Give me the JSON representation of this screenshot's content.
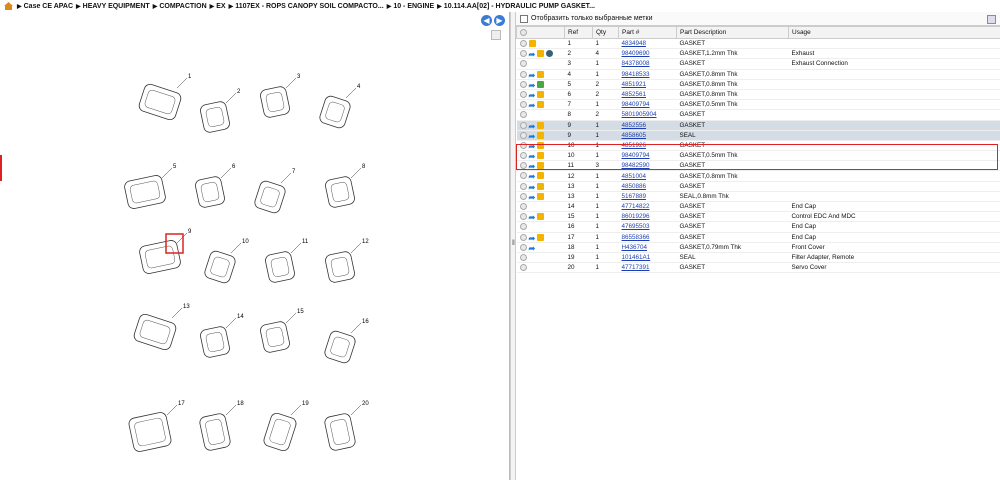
{
  "breadcrumb": [
    "Case CE APAC",
    "HEAVY EQUIPMENT",
    "COMPACTION",
    "EX",
    "1107EX - ROPS CANOPY SOIL COMPACTO...",
    "10 - ENGINE",
    "10.114.AA[02] - HYDRAULIC PUMP GASKET..."
  ],
  "filter_label": "Отобразить только выбранные метки",
  "columns": {
    "ref": "Ref",
    "qty": "Qty",
    "part": "Part #",
    "desc": "Part Description",
    "usage": "Usage"
  },
  "diagram_labels": [
    "1",
    "2",
    "3",
    "4",
    "5",
    "6",
    "7",
    "8",
    "9",
    "10",
    "11",
    "12",
    "13",
    "14",
    "15",
    "16",
    "17",
    "18",
    "19",
    "20"
  ],
  "rows": [
    {
      "icons": [
        "box"
      ],
      "ref": "1",
      "qty": "1",
      "part": "4834948",
      "desc": "GASKET",
      "usage": ""
    },
    {
      "icons": [
        "arrow",
        "box",
        "disc"
      ],
      "ref": "2",
      "qty": "4",
      "part": "98409690",
      "desc": "GASKET,1.2mm Thk",
      "usage": "Exhaust"
    },
    {
      "icons": [],
      "ref": "3",
      "qty": "1",
      "part": "84378008",
      "desc": "GASKET",
      "usage": "Exhaust Connection"
    },
    {
      "icons": [
        "arrow",
        "box"
      ],
      "ref": "4",
      "qty": "1",
      "part": "98418533",
      "desc": "GASKET,0.8mm Thk",
      "usage": ""
    },
    {
      "icons": [
        "arrow",
        "green"
      ],
      "ref": "5",
      "qty": "2",
      "part": "4851921",
      "desc": "GASKET,0.8mm Thk",
      "usage": ""
    },
    {
      "icons": [
        "arrow",
        "box"
      ],
      "ref": "6",
      "qty": "2",
      "part": "4852561",
      "desc": "GASKET,0.8mm Thk",
      "usage": ""
    },
    {
      "icons": [
        "arrow",
        "box"
      ],
      "ref": "7",
      "qty": "1",
      "part": "98409794",
      "desc": "GASKET,0.5mm Thk",
      "usage": ""
    },
    {
      "icons": [],
      "ref": "8",
      "qty": "2",
      "part": "5801905904",
      "desc": "GASKET",
      "usage": ""
    },
    {
      "icons": [
        "arrow",
        "box"
      ],
      "ref": "9",
      "qty": "1",
      "part": "4852556",
      "desc": "GASKET",
      "usage": "",
      "sel": true
    },
    {
      "icons": [
        "arrow",
        "box"
      ],
      "ref": "9",
      "qty": "1",
      "part": "4858605",
      "desc": "SEAL",
      "usage": "",
      "sel": true
    },
    {
      "icons": [
        "arrow",
        "box"
      ],
      "ref": "10",
      "qty": "1",
      "part": "4851926",
      "desc": "GASKET",
      "usage": ""
    },
    {
      "icons": [
        "arrow",
        "box"
      ],
      "ref": "10",
      "qty": "1",
      "part": "98409794",
      "desc": "GASKET,0.5mm Thk",
      "usage": ""
    },
    {
      "icons": [
        "arrow",
        "box"
      ],
      "ref": "11",
      "qty": "3",
      "part": "98482590",
      "desc": "GASKET",
      "usage": ""
    },
    {
      "icons": [
        "arrow",
        "box"
      ],
      "ref": "12",
      "qty": "1",
      "part": "4851004",
      "desc": "GASKET,0.8mm Thk",
      "usage": ""
    },
    {
      "icons": [
        "arrow",
        "box"
      ],
      "ref": "13",
      "qty": "1",
      "part": "4850886",
      "desc": "GASKET",
      "usage": ""
    },
    {
      "icons": [
        "arrow",
        "box"
      ],
      "ref": "13",
      "qty": "1",
      "part": "5167889",
      "desc": "SEAL,0.8mm Thk",
      "usage": ""
    },
    {
      "icons": [],
      "ref": "14",
      "qty": "1",
      "part": "47714822",
      "desc": "GASKET",
      "usage": "End Cap"
    },
    {
      "icons": [
        "arrow",
        "box"
      ],
      "ref": "15",
      "qty": "1",
      "part": "86019296",
      "desc": "GASKET",
      "usage": "Control EDC And MDC"
    },
    {
      "icons": [],
      "ref": "16",
      "qty": "1",
      "part": "47695503",
      "desc": "GASKET",
      "usage": "End Cap"
    },
    {
      "icons": [
        "arrow",
        "box"
      ],
      "ref": "17",
      "qty": "1",
      "part": "86558366",
      "desc": "GASKET",
      "usage": "End Cap"
    },
    {
      "icons": [
        "arrow"
      ],
      "ref": "18",
      "qty": "1",
      "part": "H436704",
      "desc": "GASKET,0.79mm Thk",
      "usage": "Front Cover"
    },
    {
      "icons": [],
      "ref": "19",
      "qty": "1",
      "part": "101461A1",
      "desc": "SEAL",
      "usage": "Filter Adapter, Remote"
    },
    {
      "icons": [],
      "ref": "20",
      "qty": "1",
      "part": "47717391",
      "desc": "GASKET",
      "usage": "Servo Cover"
    }
  ]
}
